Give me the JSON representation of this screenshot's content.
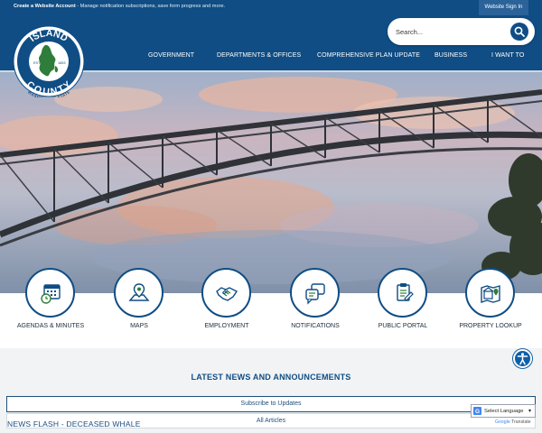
{
  "topbar": {
    "account_link": "Create a Website Account",
    "account_text": " - Manage notification subscriptions, save form progress and more.",
    "signin_label": "Website Sign In"
  },
  "search": {
    "placeholder": "Search..."
  },
  "logo": {
    "top_text": "ISLAND",
    "bottom_text": "COUNTY",
    "state_text": "WASHINGTON STATE",
    "est": "EST.",
    "year": "1853"
  },
  "nav": {
    "items": [
      {
        "label": "GOVERNMENT"
      },
      {
        "label": "DEPARTMENTS & OFFICES"
      },
      {
        "label": "COMPREHENSIVE PLAN UPDATE"
      },
      {
        "label": "BUSINESS"
      },
      {
        "label": "I WANT TO"
      }
    ]
  },
  "quick_links": [
    {
      "label": "AGENDAS & MINUTES",
      "icon": "calendar-clock-icon"
    },
    {
      "label": "MAPS",
      "icon": "map-pin-icon"
    },
    {
      "label": "EMPLOYMENT",
      "icon": "handshake-icon"
    },
    {
      "label": "NOTIFICATIONS",
      "icon": "chat-bubbles-icon"
    },
    {
      "label": "PUBLIC PORTAL",
      "icon": "document-portal-icon"
    },
    {
      "label": "PROPERTY LOOKUP",
      "icon": "property-map-icon"
    }
  ],
  "news": {
    "title": "LATEST NEWS AND ANNOUNCEMENTS",
    "subscribe_label": "Subscribe to Updates",
    "all_articles_label": "All Articles",
    "flash": "NEWS FLASH - DECEASED WHALE"
  },
  "translate": {
    "select_label": "Select Language",
    "powered_by": "Google",
    "translate_word": "Translate"
  },
  "colors": {
    "brand_blue": "#0f4d84",
    "accent_green": "#2e7d3a",
    "access_blue": "#0f5fa6"
  }
}
